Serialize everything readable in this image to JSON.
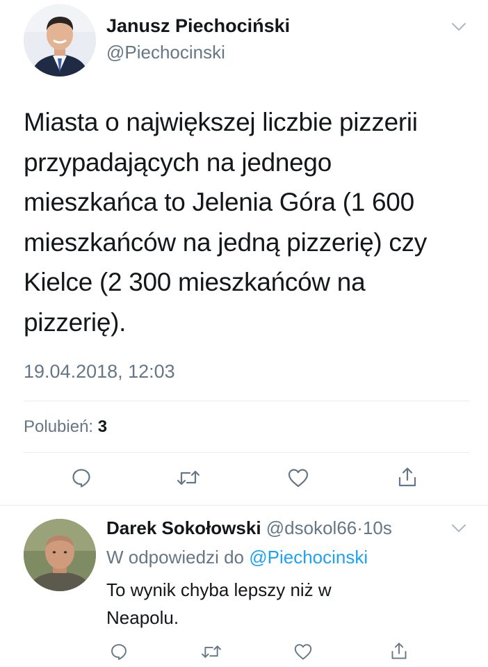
{
  "tweet": {
    "author_name": "Janusz Piechociński",
    "author_handle": "@Piechocinski",
    "text": "Miasta  o największej liczbie pizzerii\nprzypadających na jednego\nmieszkańca to Jelenia Góra (1 600\nmieszkańców na jedną pizzerię) czy\nKielce (2 300 mieszkańców na\npizzerię).",
    "timestamp": "19.04.2018, 12:03",
    "likes_label": "Polubień:",
    "likes_count": "3",
    "actions": [
      "reply-icon",
      "retweet-icon",
      "like-icon",
      "share-icon"
    ]
  },
  "reply": {
    "author_name": "Darek Sokołowski",
    "author_handle": "@dsokol66",
    "separator": "·",
    "time": "10s",
    "context_prefix": "W odpowiedzi do",
    "context_handle": "@Piechocinski",
    "text": "To wynik chyba lepszy niż w\nNeapolu.",
    "actions": [
      "reply-icon",
      "retweet-icon",
      "like-icon",
      "share-icon"
    ]
  },
  "colors": {
    "text": "#14171a",
    "secondary": "#657786",
    "link": "#1da1f2",
    "divider": "#e6ecf0",
    "icon": "#657786"
  }
}
